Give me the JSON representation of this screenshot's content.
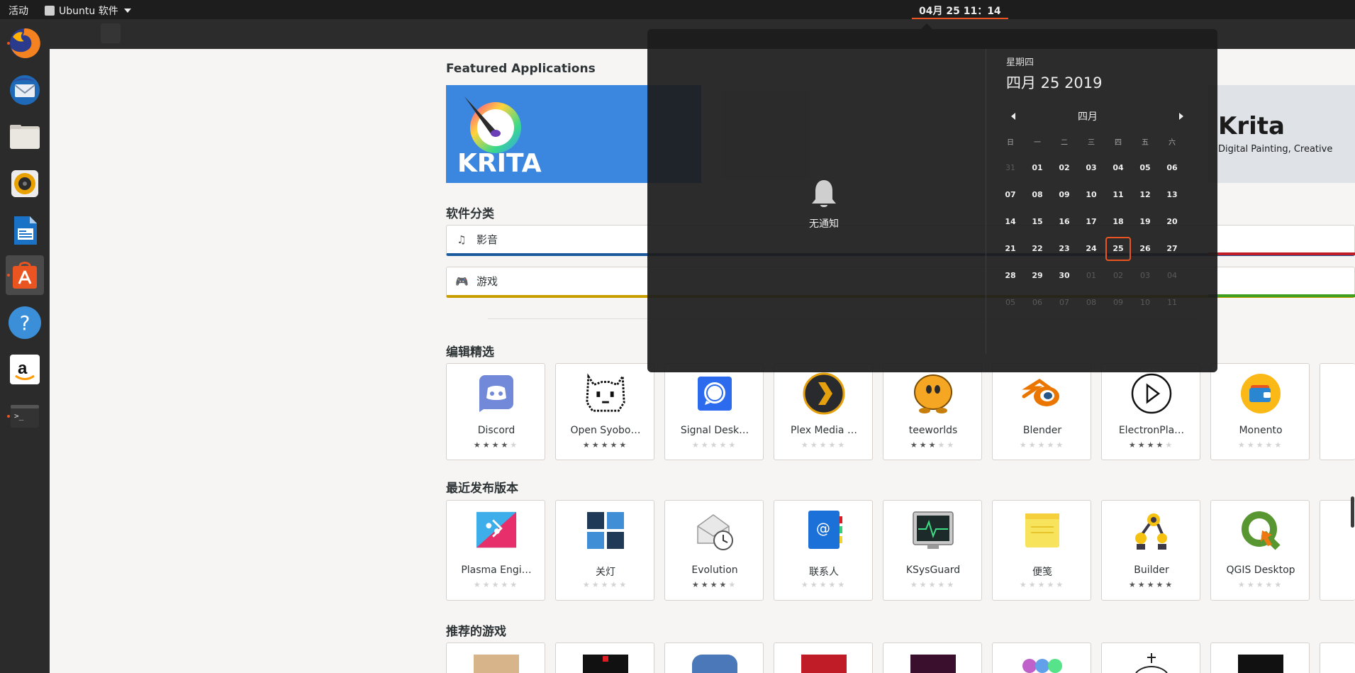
{
  "topbar": {
    "activities": "活动",
    "app_name": "Ubuntu 软件",
    "clock": "04月 25  11：14"
  },
  "dock": {
    "items": [
      {
        "name": "firefox",
        "running": true
      },
      {
        "name": "thunderbird",
        "running": false
      },
      {
        "name": "files",
        "running": false
      },
      {
        "name": "rhythmbox",
        "running": false
      },
      {
        "name": "libreoffice-writer",
        "running": false
      },
      {
        "name": "ubuntu-software",
        "running": true,
        "active": true
      },
      {
        "name": "help",
        "running": false
      },
      {
        "name": "amazon",
        "running": false
      },
      {
        "name": "terminal",
        "running": true
      }
    ]
  },
  "featured": {
    "title": "Featured Applications",
    "left_banner_text": "KRITA",
    "right_banner_title": "Krita",
    "right_banner_subtitle": "Digital Painting, Creative"
  },
  "categories": {
    "title": "软件分类",
    "items": [
      {
        "label": "影音",
        "icon": "music-note-icon",
        "color": "#1c5b9d"
      },
      {
        "label": "游戏",
        "icon": "gamepad-icon",
        "color": "#c79d00"
      }
    ],
    "right_colors": [
      "#c01c28",
      "#3e9e1e"
    ]
  },
  "editors_picks": {
    "title": "编辑精选",
    "apps": [
      {
        "name": "Discord",
        "rating": 4
      },
      {
        "name": "Open Syobo…",
        "rating": 5
      },
      {
        "name": "Signal Desk…",
        "rating": 0
      },
      {
        "name": "Plex Media …",
        "rating": 0
      },
      {
        "name": "teeworlds",
        "rating": 3
      },
      {
        "name": "Blender",
        "rating": 0
      },
      {
        "name": "ElectronPla…",
        "rating": 4
      },
      {
        "name": "Monento",
        "rating": 0
      }
    ]
  },
  "recent_releases": {
    "title": "最近发布版本",
    "apps": [
      {
        "name": "Plasma Engi…",
        "rating": 0
      },
      {
        "name": "关灯",
        "rating": 0
      },
      {
        "name": "Evolution",
        "rating": 4
      },
      {
        "name": "联系人",
        "rating": 0
      },
      {
        "name": "KSysGuard",
        "rating": 0
      },
      {
        "name": "便笺",
        "rating": 0
      },
      {
        "name": "Builder",
        "rating": 5
      },
      {
        "name": "QGIS Desktop",
        "rating": 0
      }
    ]
  },
  "recommended_games": {
    "title": "推荐的游戏"
  },
  "notifications": {
    "empty_text": "无通知"
  },
  "calendar": {
    "weekday": "星期四",
    "full_date": "四月 25 2019",
    "month": "四月",
    "weekday_headers": [
      "日",
      "一",
      "二",
      "三",
      "四",
      "五",
      "六"
    ],
    "weeks": [
      [
        "31",
        "01",
        "02",
        "03",
        "04",
        "05",
        "06"
      ],
      [
        "07",
        "08",
        "09",
        "10",
        "11",
        "12",
        "13"
      ],
      [
        "14",
        "15",
        "16",
        "17",
        "18",
        "19",
        "20"
      ],
      [
        "21",
        "22",
        "23",
        "24",
        "25",
        "26",
        "27"
      ],
      [
        "28",
        "29",
        "30",
        "01",
        "02",
        "03",
        "04"
      ],
      [
        "05",
        "06",
        "07",
        "08",
        "09",
        "10",
        "11"
      ]
    ],
    "today": "25"
  }
}
